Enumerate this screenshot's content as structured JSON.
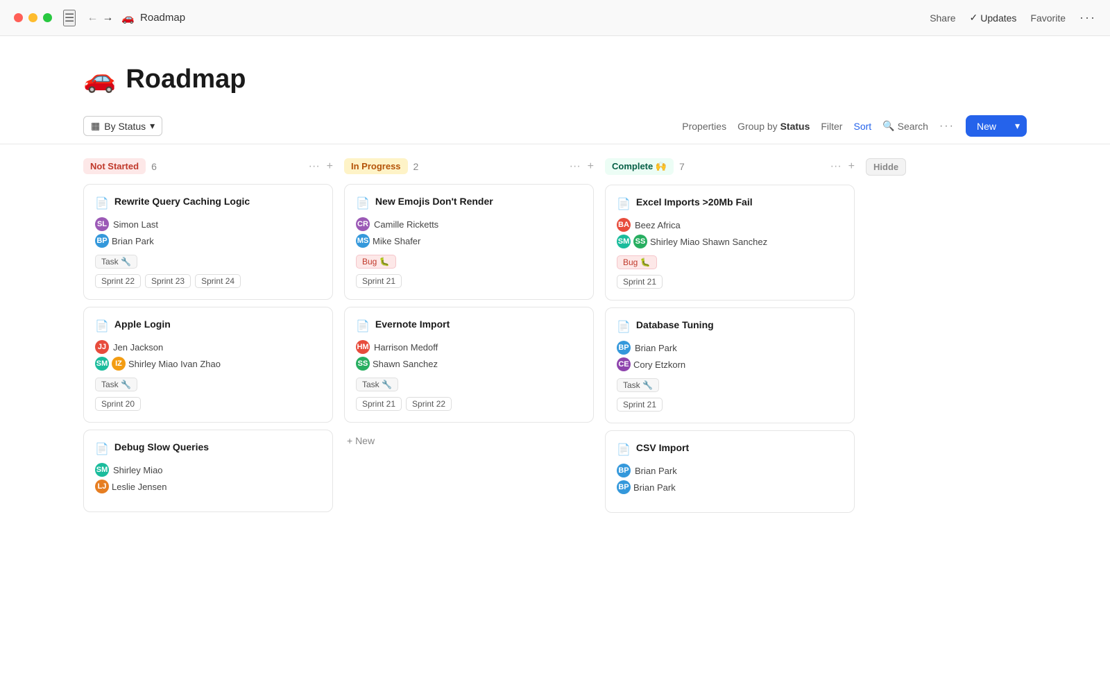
{
  "titlebar": {
    "page_icon": "🚗",
    "page_title": "Roadmap",
    "share_label": "Share",
    "updates_label": "Updates",
    "favorite_label": "Favorite",
    "more_label": "···"
  },
  "page_header": {
    "icon": "🚗",
    "title": "Roadmap"
  },
  "toolbar": {
    "by_status_label": "By Status",
    "properties_label": "Properties",
    "group_by_label": "Group by",
    "group_by_value": "Status",
    "filter_label": "Filter",
    "sort_label": "Sort",
    "search_label": "Search",
    "more_label": "···",
    "new_label": "New"
  },
  "columns": [
    {
      "id": "not-started",
      "status": "Not Started",
      "status_class": "not-started",
      "count": 6,
      "cards": [
        {
          "title": "Rewrite Query Caching Logic",
          "assignees": [
            {
              "name": "Simon Last",
              "color": "#9b59b6",
              "initials": "SL"
            },
            {
              "name": "Brian Park",
              "color": "#3498db",
              "initials": "BP"
            }
          ],
          "tag": "Task 🔧",
          "tag_class": "",
          "sprints": [
            "Sprint 22",
            "Sprint 23",
            "Sprint 24"
          ]
        },
        {
          "title": "Apple Login",
          "assignees": [
            {
              "name": "Jen Jackson",
              "color": "#e74c3c",
              "initials": "JJ"
            },
            {
              "name": "Shirley Miao",
              "color": "#1abc9c",
              "initials": "SM"
            },
            {
              "name": "Ivan Zhao",
              "color": "#f39c12",
              "initials": "IZ"
            }
          ],
          "tag": "Task 🔧",
          "tag_class": "",
          "sprints": [
            "Sprint 20"
          ]
        },
        {
          "title": "Debug Slow Queries",
          "assignees": [
            {
              "name": "Shirley Miao",
              "color": "#1abc9c",
              "initials": "SM"
            },
            {
              "name": "Leslie Jensen",
              "color": "#e67e22",
              "initials": "LJ"
            }
          ],
          "tag": "",
          "tag_class": "",
          "sprints": []
        }
      ]
    },
    {
      "id": "in-progress",
      "status": "In Progress",
      "status_class": "in-progress",
      "count": 2,
      "cards": [
        {
          "title": "New Emojis Don't Render",
          "assignees": [
            {
              "name": "Camille Ricketts",
              "color": "#9b59b6",
              "initials": "CR"
            },
            {
              "name": "Mike Shafer",
              "color": "#3498db",
              "initials": "MS"
            }
          ],
          "tag": "Bug 🐛",
          "tag_class": "bug",
          "sprints": [
            "Sprint 21"
          ]
        },
        {
          "title": "Evernote Import",
          "assignees": [
            {
              "name": "Harrison Medoff",
              "color": "#e74c3c",
              "initials": "HM"
            },
            {
              "name": "Shawn Sanchez",
              "color": "#27ae60",
              "initials": "SS"
            }
          ],
          "tag": "Task 🔧",
          "tag_class": "",
          "sprints": [
            "Sprint 21",
            "Sprint 22"
          ]
        }
      ],
      "show_add_new": true
    },
    {
      "id": "complete",
      "status": "Complete 🙌",
      "status_class": "complete",
      "count": 7,
      "cards": [
        {
          "title": "Excel Imports >20Mb Fail",
          "assignees": [
            {
              "name": "Beez Africa",
              "color": "#e74c3c",
              "initials": "BA"
            },
            {
              "name": "Shirley Miao",
              "color": "#1abc9c",
              "initials": "SM"
            },
            {
              "name": "Shawn Sanchez",
              "color": "#27ae60",
              "initials": "SS"
            }
          ],
          "tag": "Bug 🐛",
          "tag_class": "bug",
          "sprints": [
            "Sprint 21"
          ]
        },
        {
          "title": "Database Tuning",
          "assignees": [
            {
              "name": "Brian Park",
              "color": "#3498db",
              "initials": "BP"
            },
            {
              "name": "Cory Etzkorn",
              "color": "#8e44ad",
              "initials": "CE"
            }
          ],
          "tag": "Task 🔧",
          "tag_class": "",
          "sprints": [
            "Sprint 21"
          ]
        },
        {
          "title": "CSV Import",
          "assignees": [
            {
              "name": "Brian Park",
              "color": "#3498db",
              "initials": "BP"
            },
            {
              "name": "Brian Park",
              "color": "#3498db",
              "initials": "BP"
            }
          ],
          "tag": "",
          "tag_class": "",
          "sprints": []
        }
      ]
    }
  ],
  "hidden_col": {
    "label": "Hidde"
  },
  "add_new_label": "+ New"
}
